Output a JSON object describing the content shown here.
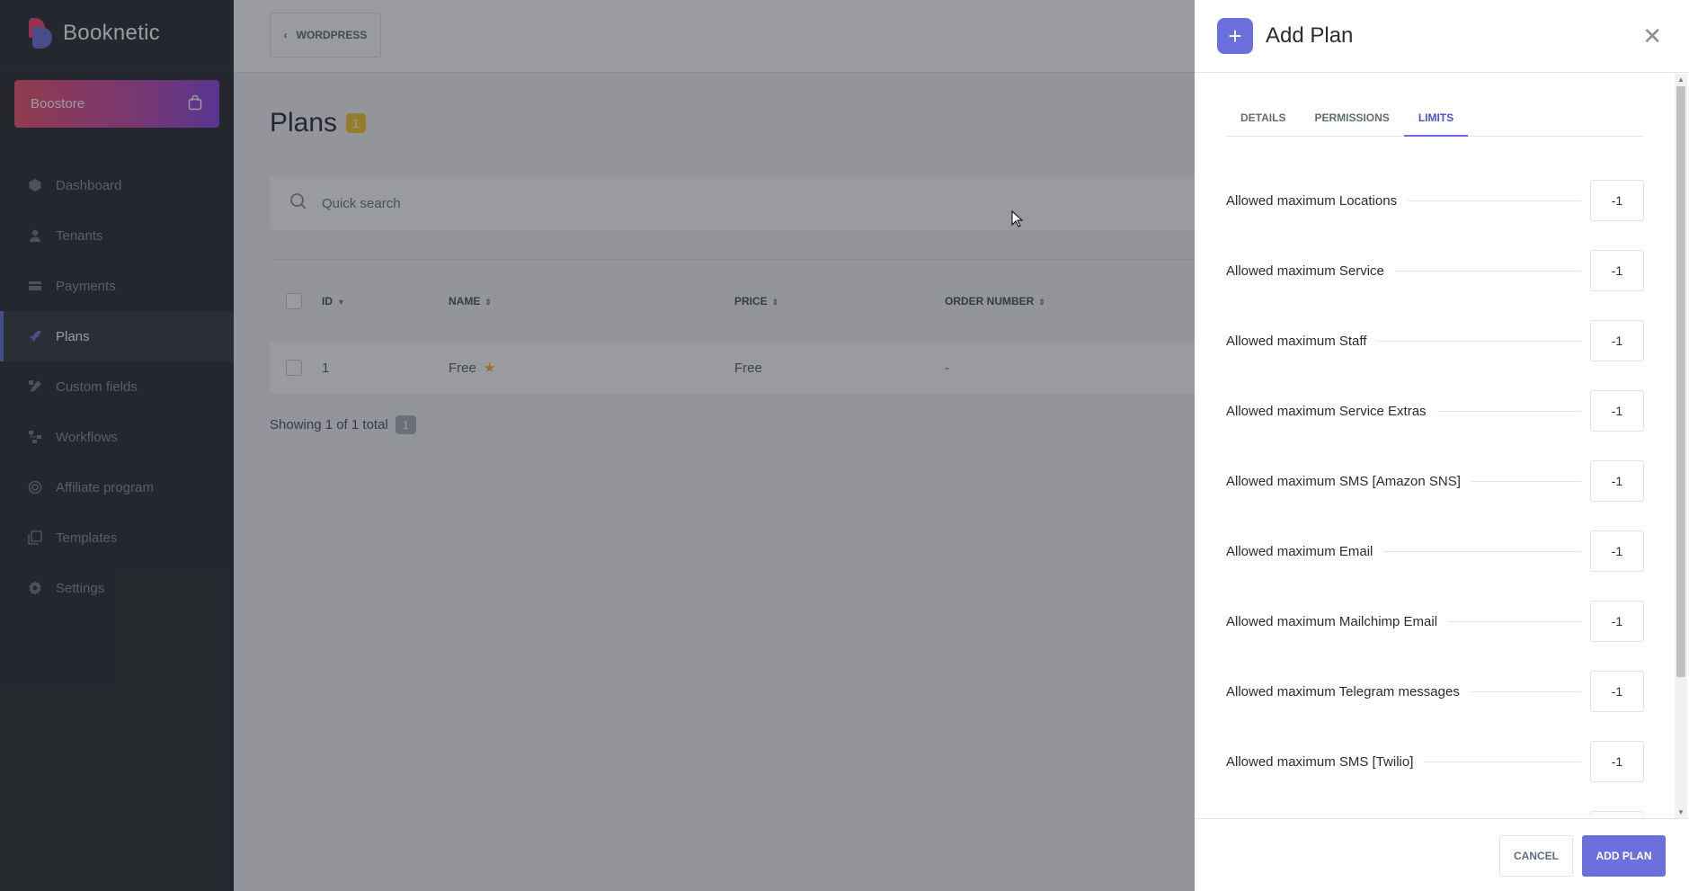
{
  "app": {
    "name": "Booknetic"
  },
  "boostore": {
    "label": "Boostore",
    "icon": "shopping-bag-icon"
  },
  "sidebar": {
    "items": [
      {
        "label": "Dashboard",
        "icon": "cube-icon"
      },
      {
        "label": "Tenants",
        "icon": "user-icon"
      },
      {
        "label": "Payments",
        "icon": "credit-card-icon"
      },
      {
        "label": "Plans",
        "icon": "rocket-icon",
        "active": true
      },
      {
        "label": "Custom fields",
        "icon": "pen-ruler-icon"
      },
      {
        "label": "Workflows",
        "icon": "workflow-icon"
      },
      {
        "label": "Affiliate program",
        "icon": "target-icon"
      },
      {
        "label": "Templates",
        "icon": "templates-icon"
      },
      {
        "label": "Settings",
        "icon": "gear-icon"
      }
    ]
  },
  "topbar": {
    "back_label": "WORDPRESS"
  },
  "page": {
    "title": "Plans",
    "count": "1"
  },
  "search": {
    "placeholder": "Quick search"
  },
  "table": {
    "columns": [
      "ID",
      "NAME",
      "PRICE",
      "ORDER NUMBER"
    ],
    "rows": [
      {
        "id": "1",
        "name": "Free",
        "price": "Free",
        "order": "-"
      }
    ]
  },
  "pagination": {
    "showing": "Showing 1 of 1 total",
    "page": "1"
  },
  "drawer": {
    "title": "Add Plan",
    "tabs": [
      "DETAILS",
      "PERMISSIONS",
      "LIMITS"
    ],
    "active_tab": "LIMITS",
    "limits": [
      {
        "label": "Allowed maximum Locations",
        "value": "-1"
      },
      {
        "label": "Allowed maximum Service",
        "value": "-1"
      },
      {
        "label": "Allowed maximum Staff",
        "value": "-1"
      },
      {
        "label": "Allowed maximum Service Extras",
        "value": "-1"
      },
      {
        "label": "Allowed maximum SMS [Amazon SNS]",
        "value": "-1"
      },
      {
        "label": "Allowed maximum Email",
        "value": "-1"
      },
      {
        "label": "Allowed maximum Mailchimp Email",
        "value": "-1"
      },
      {
        "label": "Allowed maximum Telegram messages",
        "value": "-1"
      },
      {
        "label": "Allowed maximum SMS [Twilio]",
        "value": "-1"
      }
    ],
    "cancel_label": "CANCEL",
    "submit_label": "ADD PLAN"
  },
  "colors": {
    "accent": "#6c70dc",
    "sidebar_bg": "#292d32",
    "badge": "#f8c62f"
  }
}
